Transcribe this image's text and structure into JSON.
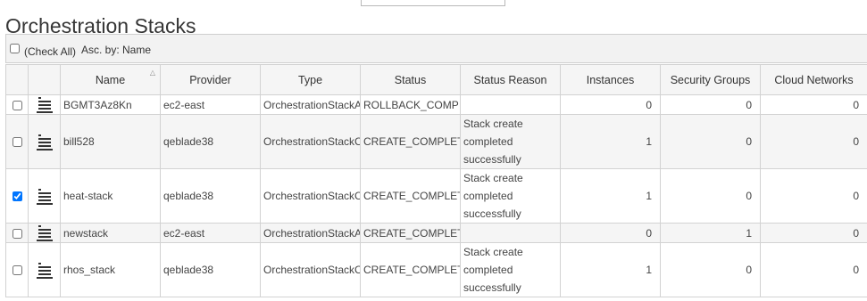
{
  "page": {
    "title": "Orchestration Stacks"
  },
  "toolbar": {
    "check_all_label": "(Check All)",
    "sort_label": "Asc. by: Name"
  },
  "columns": {
    "name": "Name",
    "provider": "Provider",
    "type": "Type",
    "status": "Status",
    "status_reason": "Status Reason",
    "instances": "Instances",
    "security_groups": "Security Groups",
    "cloud_networks": "Cloud Networks"
  },
  "sort_indicator_icon": "sort-ascending-icon",
  "row_icon": "stack-icon",
  "rows": [
    {
      "checked": false,
      "name": "BGMT3Az8Kn",
      "provider": "ec2-east",
      "type": "OrchestrationStackA",
      "status": "ROLLBACK_COMP",
      "status_reason": "",
      "instances": "0",
      "security_groups": "0",
      "cloud_networks": "0"
    },
    {
      "checked": false,
      "name": "bill528",
      "provider": "qeblade38",
      "type": "OrchestrationStackC",
      "status": "CREATE_COMPLETE",
      "status_reason": "Stack create completed successfully",
      "instances": "1",
      "security_groups": "0",
      "cloud_networks": "0"
    },
    {
      "checked": true,
      "name": "heat-stack",
      "provider": "qeblade38",
      "type": "OrchestrationStackC",
      "status": "CREATE_COMPLETE",
      "status_reason": "Stack create completed successfully",
      "instances": "1",
      "security_groups": "0",
      "cloud_networks": "0"
    },
    {
      "checked": false,
      "name": "newstack",
      "provider": "ec2-east",
      "type": "OrchestrationStackA",
      "status": "CREATE_COMPLETE",
      "status_reason": "",
      "instances": "0",
      "security_groups": "1",
      "cloud_networks": "0"
    },
    {
      "checked": false,
      "name": "rhos_stack",
      "provider": "qeblade38",
      "type": "OrchestrationStackC",
      "status": "CREATE_COMPLETE",
      "status_reason": "Stack create completed successfully",
      "instances": "1",
      "security_groups": "0",
      "cloud_networks": "0"
    }
  ]
}
